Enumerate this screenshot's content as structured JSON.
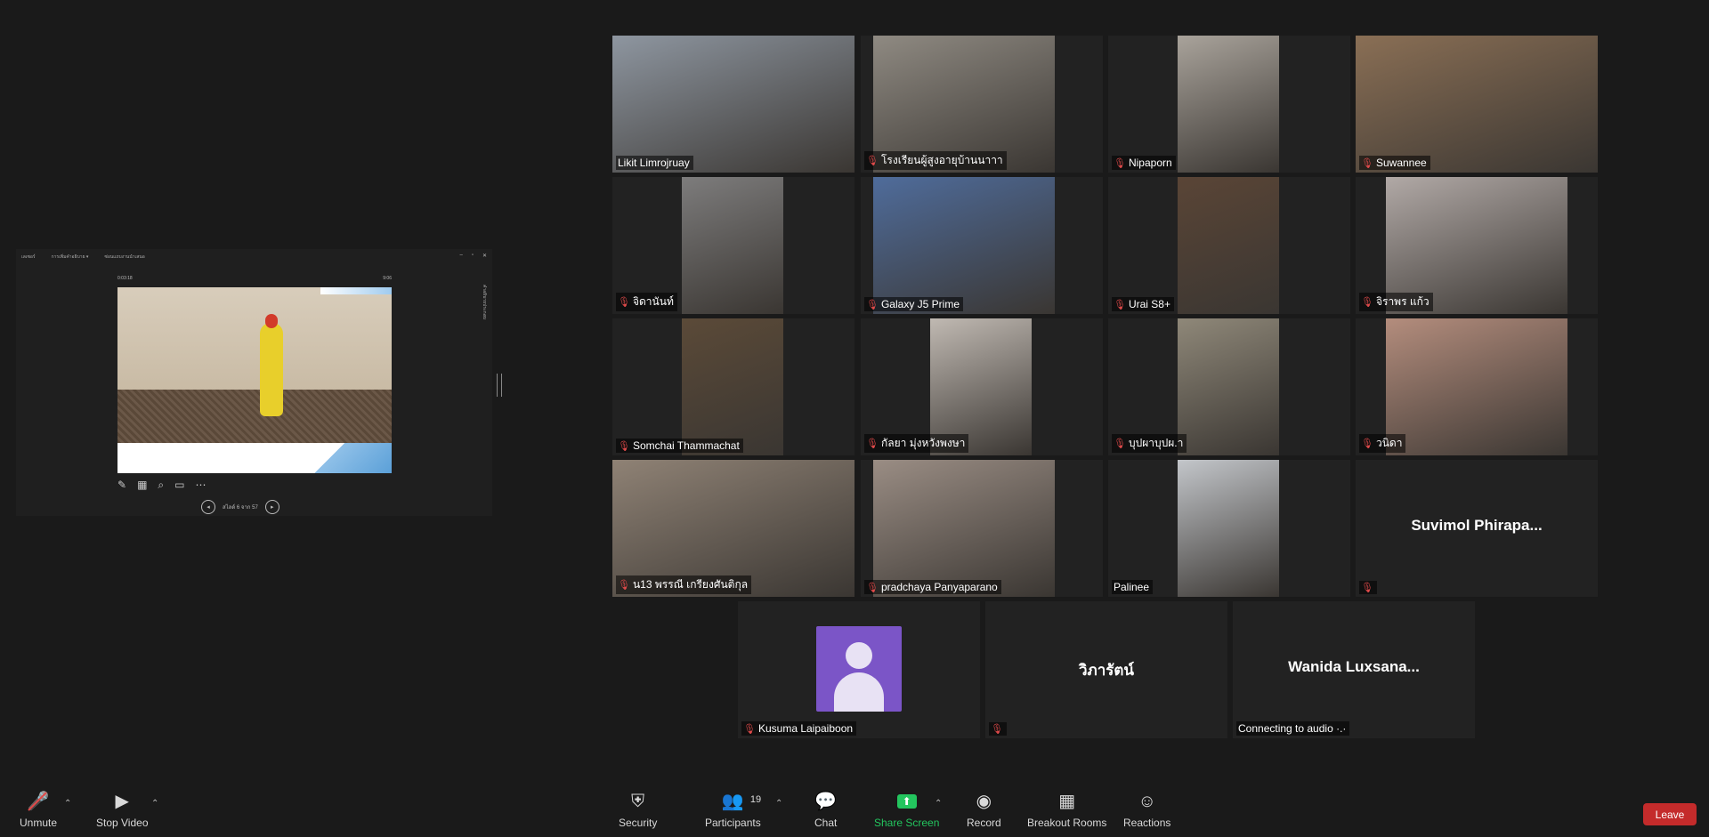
{
  "share": {
    "menu_items": [
      "เลเซอร์",
      "การเพิ่มคำอธิบาย ▾",
      "ซ่อนแถบงานนำเสนอ"
    ],
    "elapsed": "0:03:18",
    "clock": "9:06",
    "slide_counter": "สไลด์ 6 จาก 57",
    "side_label": "คำอธิบายประกอบ"
  },
  "tiles": [
    {
      "name": "Likit Limrojruay",
      "muted": false,
      "active": true,
      "video": "#8e96a0"
    },
    {
      "name": "โรงเรียนผู้สูงอายุบ้านนาาา",
      "muted": true,
      "video": "#8f8a82"
    },
    {
      "name": "Nipaporn",
      "muted": true,
      "video": "#a9a39b"
    },
    {
      "name": "Suwannee",
      "muted": true,
      "video": "#8a6f55"
    },
    {
      "name": "จิดานันท์",
      "muted": true,
      "video": "#7d7c7c"
    },
    {
      "name": "Galaxy J5 Prime",
      "muted": true,
      "video": "#4f6c9b"
    },
    {
      "name": "Urai S8+",
      "muted": true,
      "video": "#5a4536"
    },
    {
      "name": "จิราพร แก้ว",
      "muted": true,
      "video": "#b1a9a6"
    },
    {
      "name": "Somchai Thammachat",
      "muted": true,
      "video": "#5b4a38"
    },
    {
      "name": "กัลยา มุ่งหวังพงษา",
      "muted": true,
      "video": "#c0b9b2"
    },
    {
      "name": "บุปผาบุปผ.า",
      "muted": true,
      "video": "#8f8879"
    },
    {
      "name": "วนิดา",
      "muted": true,
      "video": "#b48d7d"
    },
    {
      "name": "น13 พรรณี เกรียงศันติกุล",
      "muted": true,
      "video": "#8f8275"
    },
    {
      "name": "pradchaya Panyaparano",
      "muted": true,
      "video": "#9a8d84"
    },
    {
      "name": "Palinee",
      "muted": false,
      "video": "#c3c6ca"
    },
    {
      "name": "",
      "bigname": "Suvimol  Phirapa...",
      "muted": true,
      "video": ""
    },
    {
      "name": "Kusuma Laipaiboon",
      "muted": true,
      "video": "",
      "avatar": true
    },
    {
      "name": "",
      "bigname": "วิภารัตน์",
      "muted": true,
      "video": ""
    },
    {
      "name": "Connecting to audio ·.·",
      "bigname": "Wanida  Luxsana...",
      "muted": false,
      "video": ""
    }
  ],
  "toolbar": {
    "unmute": "Unmute",
    "stop_video": "Stop Video",
    "security": "Security",
    "participants": "Participants",
    "participants_count": "19",
    "chat": "Chat",
    "share_screen": "Share Screen",
    "record": "Record",
    "breakout": "Breakout Rooms",
    "reactions": "Reactions",
    "leave": "Leave"
  },
  "colors": {
    "active_border": "#d5e27a",
    "leave": "#c42b2b",
    "share_green": "#23c55e",
    "muted_red": "#e04a4a"
  }
}
